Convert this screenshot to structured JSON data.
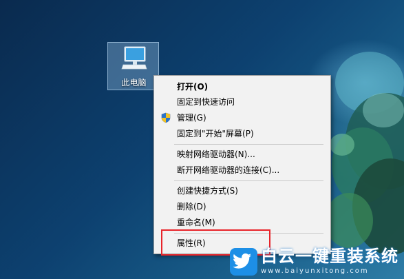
{
  "desktop": {
    "icon_label": "此电脑"
  },
  "context_menu": {
    "items": [
      {
        "label": "打开(O)",
        "bold": true
      },
      {
        "label": "固定到快速访问"
      },
      {
        "label": "管理(G)",
        "icon": "uac-shield-icon"
      },
      {
        "label": "固定到\"开始\"屏幕(P)"
      },
      {
        "label": "映射网络驱动器(N)..."
      },
      {
        "label": "断开网络驱动器的连接(C)..."
      },
      {
        "label": "创建快捷方式(S)"
      },
      {
        "label": "删除(D)"
      },
      {
        "label": "重命名(M)"
      },
      {
        "label": "属性(R)"
      }
    ]
  },
  "watermark": {
    "title": "白云一键重装系统",
    "url": "www.baiyunxitong.com",
    "icon": "twitter-bird-icon"
  },
  "colors": {
    "highlight_border": "#e8242a",
    "menu_background": "#f2f2f2",
    "desktop_blue": "#0d4170"
  }
}
